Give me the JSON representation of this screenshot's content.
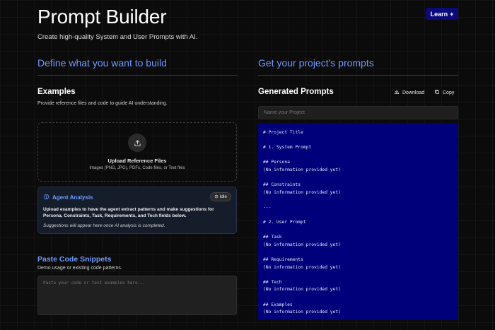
{
  "header": {
    "title": "Prompt Builder",
    "subtitle": "Create high-quality System and User Prompts with AI.",
    "learn_label": "Learn",
    "learn_icon": "plus-icon"
  },
  "left": {
    "section_title": "Define what you want to build",
    "examples": {
      "title": "Examples",
      "description": "Provide reference files and code to guide AI understanding."
    },
    "upload": {
      "icon": "upload-icon",
      "title": "Upload Reference Files",
      "subtitle": "Images (PNG, JPG), PDFs, Code files, or Text files"
    },
    "agent": {
      "icon": "brain-icon",
      "title": "Agent Analysis",
      "status": "Idle",
      "status_icon": "brain-icon",
      "description": "Upload examples to have the agent extract patterns and make suggestions for Persona, Constraints, Task, Requirements, and Tech fields below.",
      "note": "Suggestions will appear here once AI analysis is completed."
    },
    "paste": {
      "title": "Paste Code Snippets",
      "subtitle": "Demo usage or existing code patterns.",
      "placeholder": "Paste your code or text examples here..."
    }
  },
  "right": {
    "section_title": "Get your project's prompts",
    "generated_title": "Generated Prompts",
    "download_label": "Download",
    "copy_label": "Copy",
    "project_placeholder": "Name your Project",
    "prompt_lines": [
      "# Project Title",
      "",
      "# 1. System Prompt",
      "",
      "## Persona",
      "(No information provided yet)",
      "",
      "## Constraints",
      "(No information provided yet)",
      "",
      "---",
      "",
      "# 2. User Prompt",
      "",
      "## Task",
      "(No information provided yet)",
      "",
      "## Requirements",
      "(No information provided yet)",
      "",
      "## Tech",
      "(No information provided yet)",
      "",
      "## Examples",
      "(No information provided yet)"
    ]
  },
  "colors": {
    "accent": "#6f9bff",
    "learn_button": "#0a0a7a",
    "prompt_panel": "#00007a",
    "background": "#0b0b0b"
  }
}
